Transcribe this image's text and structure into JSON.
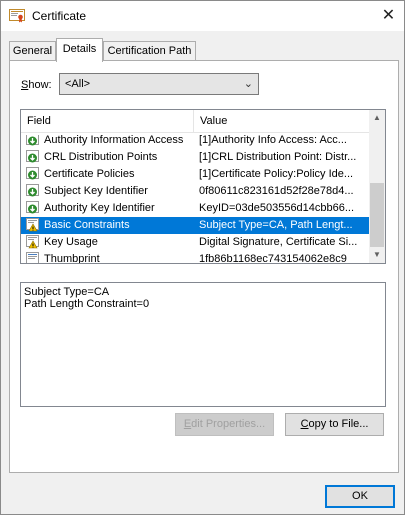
{
  "window": {
    "title": "Certificate",
    "close_glyph": "✕"
  },
  "tabs": [
    {
      "label": "General",
      "active": false
    },
    {
      "label": "Details",
      "active": true
    },
    {
      "label": "Certification Path",
      "active": false
    }
  ],
  "show": {
    "label_prefix": "S",
    "label_rest": "how:",
    "value": "<All>"
  },
  "columns": {
    "field": "Field",
    "value": "Value"
  },
  "rows": [
    {
      "field": "Authority Information Access",
      "value": "[1]Authority Info Access: Acc...",
      "icon": "extension-icon"
    },
    {
      "field": "CRL Distribution Points",
      "value": "[1]CRL Distribution Point: Distr...",
      "icon": "extension-icon"
    },
    {
      "field": "Certificate Policies",
      "value": "[1]Certificate Policy:Policy Ide...",
      "icon": "extension-icon"
    },
    {
      "field": "Subject Key Identifier",
      "value": "0f80611c823161d52f28e78d4...",
      "icon": "extension-icon"
    },
    {
      "field": "Authority Key Identifier",
      "value": "KeyID=03de503556d14cbb66...",
      "icon": "extension-icon"
    },
    {
      "field": "Basic Constraints",
      "value": "Subject Type=CA, Path Lengt...",
      "icon": "critical-extension-icon",
      "selected": true
    },
    {
      "field": "Key Usage",
      "value": "Digital Signature, Certificate Si...",
      "icon": "critical-extension-icon"
    },
    {
      "field": "Thumbprint",
      "value": "1fb86b1168ec743154062e8c9",
      "icon": "property-icon"
    }
  ],
  "detail": {
    "line1": "Subject Type=CA",
    "line2": "Path Length Constraint=0"
  },
  "buttons": {
    "edit_properties": {
      "mnemonic": "E",
      "rest": "dit Properties..."
    },
    "copy_to_file": {
      "mnemonic": "C",
      "rest": "opy to File..."
    },
    "ok": "OK"
  },
  "colors": {
    "selection": "#0078d7",
    "window_bg": "#f0f0f0",
    "panel_bg": "#ffffff"
  }
}
